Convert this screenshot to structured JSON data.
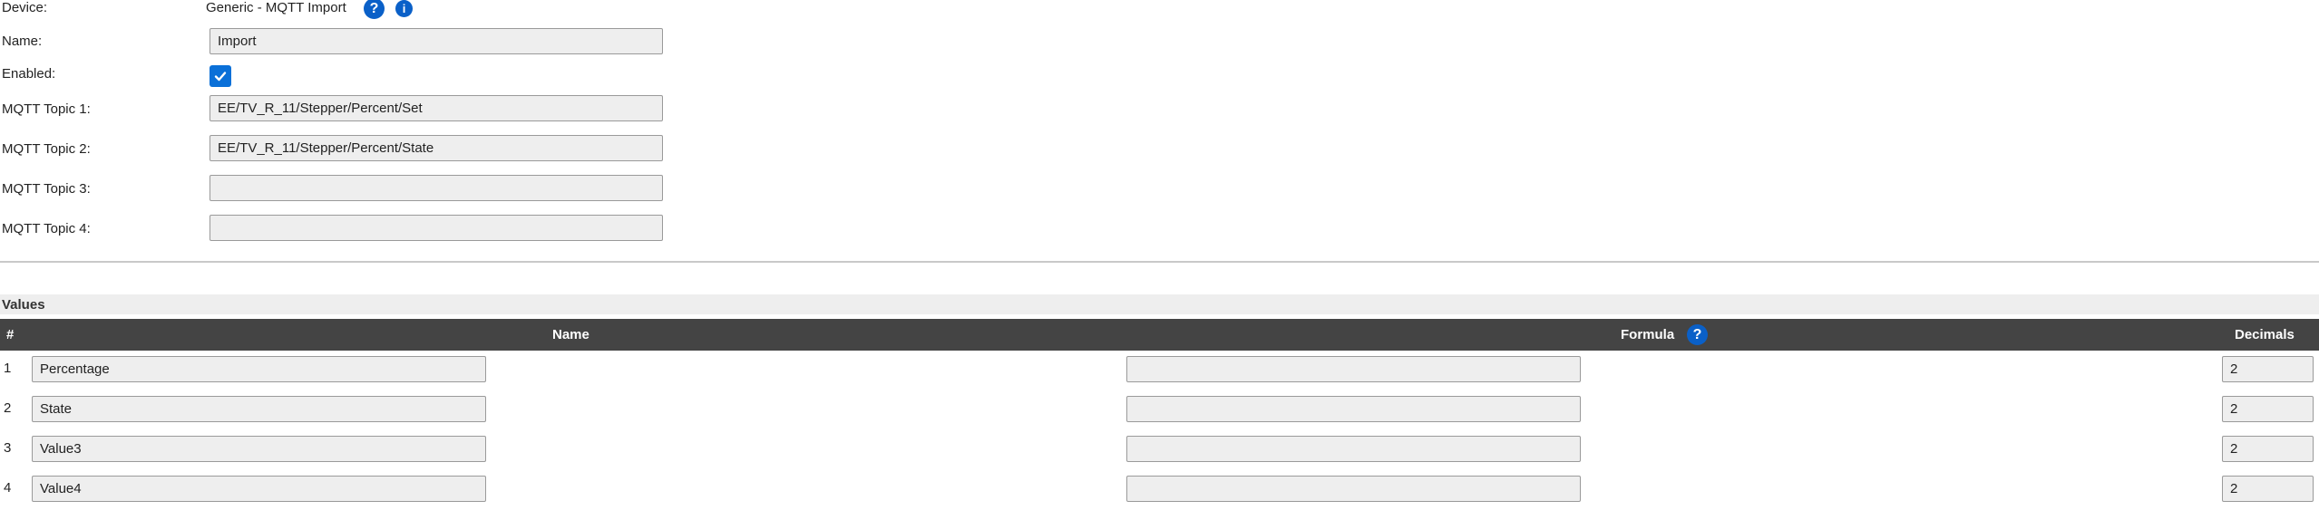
{
  "device": {
    "label": "Device:",
    "value": "Generic - MQTT Import"
  },
  "fields": {
    "name": {
      "label": "Name:",
      "value": "Import"
    },
    "enabled": {
      "label": "Enabled:",
      "checked": true
    },
    "topic1": {
      "label": "MQTT Topic 1:",
      "value": "EE/TV_R_11/Stepper/Percent/Set"
    },
    "topic2": {
      "label": "MQTT Topic 2:",
      "value": "EE/TV_R_11/Stepper/Percent/State"
    },
    "topic3": {
      "label": "MQTT Topic 3:",
      "value": ""
    },
    "topic4": {
      "label": "MQTT Topic 4:",
      "value": ""
    }
  },
  "values_section": {
    "title": "Values",
    "headers": {
      "num": "#",
      "name": "Name",
      "formula": "Formula",
      "decimals": "Decimals"
    },
    "rows": [
      {
        "num": "1",
        "name": "Percentage",
        "formula": "",
        "decimals": "2"
      },
      {
        "num": "2",
        "name": "State",
        "formula": "",
        "decimals": "2"
      },
      {
        "num": "3",
        "name": "Value3",
        "formula": "",
        "decimals": "2"
      },
      {
        "num": "4",
        "name": "Value4",
        "formula": "",
        "decimals": "2"
      }
    ]
  },
  "icons": {
    "help": "?",
    "info": "i"
  },
  "colors": {
    "accent": "#0a60c8",
    "table_header": "#444444",
    "input_bg": "#eeeeee"
  }
}
